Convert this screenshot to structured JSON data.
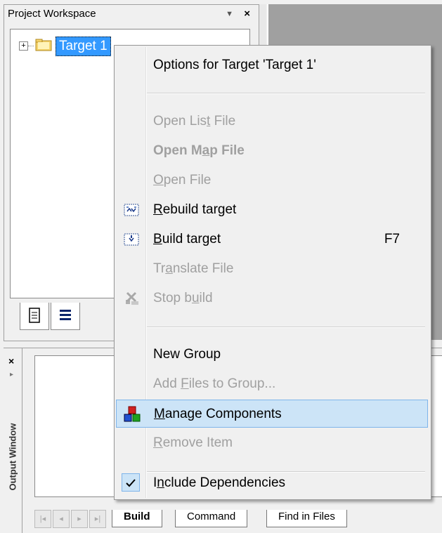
{
  "workspace": {
    "title": "Project Workspace",
    "pin_icon": "pin-down-icon",
    "close_label": "×",
    "tree_item_label": "Target 1",
    "tab_files_icon": "files-tab-icon",
    "tab_books_icon": "books-tab-icon"
  },
  "output": {
    "close_label": "×",
    "vertical_title": "Output Window",
    "tabs": [
      "Build",
      "Command",
      "Find in Files"
    ]
  },
  "menu": {
    "options": "Options for Target 'Target 1'",
    "open_list": [
      "Open List",
      "File"
    ],
    "open_map": "Open Map File",
    "open_file": "Open File",
    "rebuild": "Rebuild target",
    "build": "Build target",
    "build_shortcut": "F7",
    "translate": "Translate File",
    "stop": "Stop build",
    "new_group": "New Group",
    "add_files": "Add Files to Group...",
    "manage": "Manage Components",
    "remove": "Remove Item",
    "include": "Include Dependencies"
  },
  "colors": {
    "selection": "#3399ff",
    "menu_highlight": "#cce4f7",
    "menu_highlight_border": "#7eb4ea",
    "disabled_text": "#a0a0a0"
  }
}
